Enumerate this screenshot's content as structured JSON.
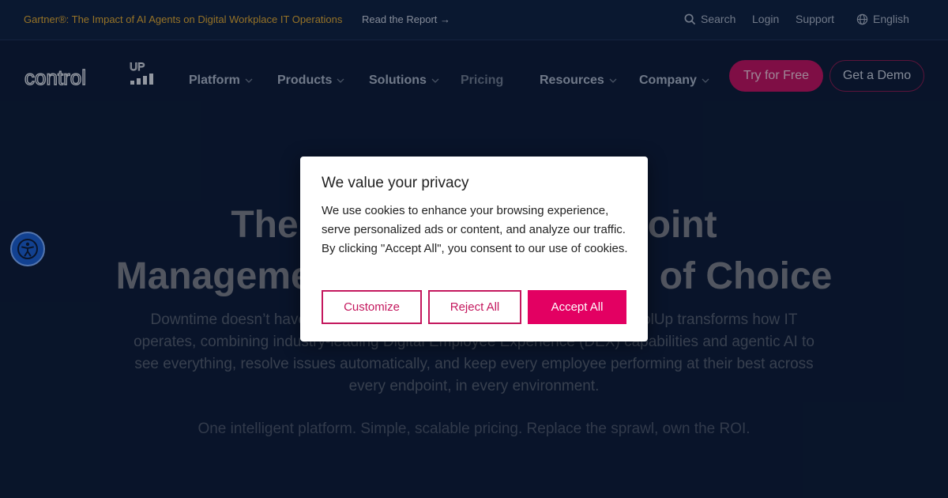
{
  "topbar": {
    "promo_text": "Gartner®: The Impact of AI Agents on Digital Workplace IT Operations",
    "promo_link": "Read the Report",
    "search": "Search",
    "login": "Login",
    "support": "Support",
    "language": "English"
  },
  "nav": {
    "logo_text": "control",
    "logo_up": "UP",
    "platform": "Platform",
    "products": "Products",
    "solutions": "Solutions",
    "pricing": "Pricing",
    "resources": "Resources",
    "company": "Company",
    "try_free": "Try for Free",
    "demo": "Get a Demo"
  },
  "hero": {
    "title_line1_left": "The",
    "title_line1_right": "oint",
    "title_line2_left": "Manageme",
    "title_line2_right": "of Choice",
    "body_line1_left": "Downtime doesn’t have",
    "body_line1_right": "olUp transforms how IT",
    "body_line2": "operates, combining industry-leading Digital Employee Experience (DEX) capabilities and agentic AI to",
    "body_line3": "see everything, resolve issues automatically, and keep every employee performing at their best across",
    "body_line4": "every endpoint, in every environment.",
    "tagline": "One intelligent platform. Simple, scalable pricing. Replace the sprawl, own the ROI."
  },
  "cookie": {
    "title": "We value your privacy",
    "text": "We use cookies to enhance your browsing experience, serve personalized ads or content, and analyze our traffic. By clicking \"Accept All\", you consent to our use of cookies.",
    "customize": "Customize",
    "reject": "Reject All",
    "accept": "Accept All"
  },
  "colors": {
    "background": "#0b1a33",
    "accent": "#e30062",
    "promo": "#e2a92e"
  },
  "icons": {
    "search": "search-icon",
    "globe": "globe-icon",
    "arrow": "arrow-right-icon",
    "chevron": "chevron-down-icon",
    "accessibility": "accessibility-icon"
  }
}
